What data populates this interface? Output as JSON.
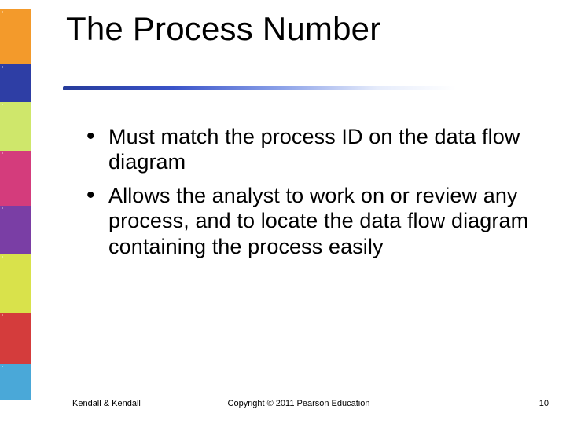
{
  "title": "The Process Number",
  "bullets": [
    "Must match the process ID on the data flow diagram",
    "Allows the analyst to work on or review any process, and to locate the data flow diagram containing the process easily"
  ],
  "footer": {
    "left": "Kendall & Kendall",
    "center": "Copyright © 2011 Pearson Education",
    "right": "10"
  }
}
